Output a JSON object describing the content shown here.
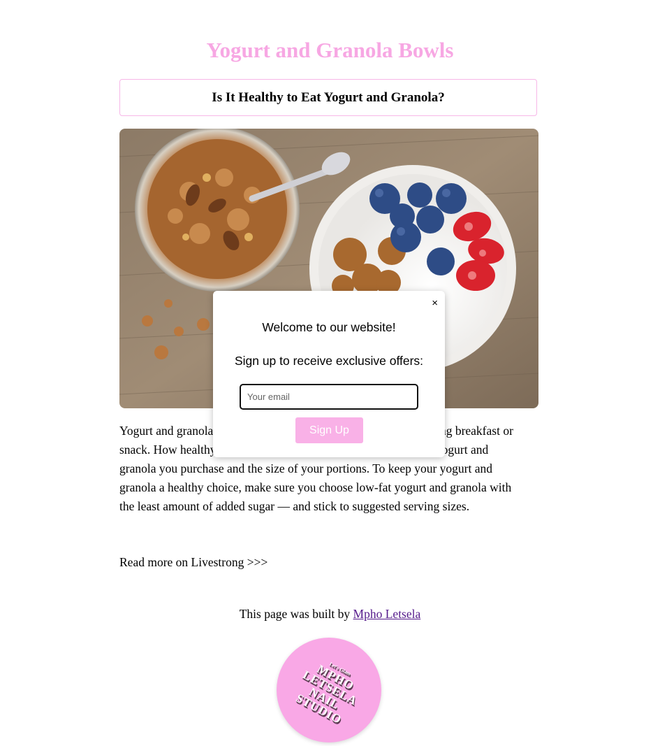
{
  "page": {
    "title": "Yogurt and Granola Bowls",
    "subtitle": "Is It Healthy to Eat Yogurt and Granola?",
    "article": "Yogurt and granola can make a nutritious, convenient and satisfying breakfast or snack. How healthy they are depends entirely on the varieties of yogurt and granola you purchase and the size of your portions. To keep your yogurt and granola a healthy choice, make sure you choose low-fat yogurt and granola with the least amount of added sugar — and stick to suggested serving sizes.",
    "read_more": "Read more on Livestrong >>>",
    "credit_prefix": "This page was built by ",
    "credit_link": "Mpho Letsela"
  },
  "logo": {
    "small_text": "Let's Glam",
    "line1": "MPHO",
    "line2": "LETSELA",
    "line3": "NAIL",
    "line4": "STUDIO"
  },
  "popup": {
    "close_label": "×",
    "welcome": "Welcome to our website!",
    "signup_text": "Sign up to receive exclusive offers:",
    "email_placeholder": "Your email",
    "email_value": "",
    "submit_label": "Sign Up"
  },
  "colors": {
    "accent_pink": "#f7a7e3",
    "button_pink": "#f9b1e7",
    "link_purple": "#551a8b"
  }
}
